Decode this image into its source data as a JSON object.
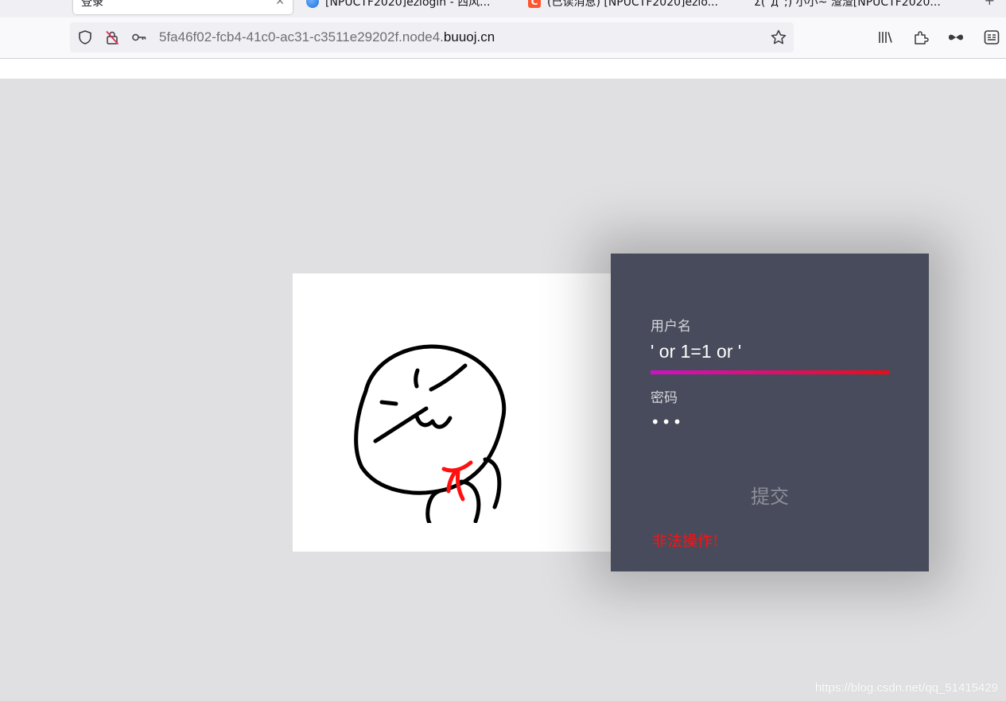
{
  "browser": {
    "tabs": [
      {
        "label": "登录",
        "active": true,
        "favicon": "none"
      },
      {
        "label": "[NPUCTF2020]ezlogin - 西风...",
        "active": false,
        "favicon": "globe-icon"
      },
      {
        "label": "(已读消息) [NPUCTF2020]ezlo...",
        "active": false,
        "favicon": "csdn-icon"
      },
      {
        "label": "Σ(ﾟдﾟ;) 小小~ 渣渣[NPUCTF2020...",
        "active": false,
        "favicon": "none"
      }
    ],
    "new_tab_label": "+",
    "url": {
      "prefix": "5fa46f02-fcb4-41c0-ac31-c3511e29202f.node4.",
      "host": "buuoj.cn"
    },
    "toolbar_icons": [
      "library-icon",
      "extensions-icon",
      "private-browsing-icon",
      "reader-view-icon"
    ]
  },
  "login": {
    "username_label": "用户名",
    "username_value": "' or 1=1 or '",
    "password_label": "密码",
    "password_value": "•••",
    "submit_label": "提交",
    "error_message": "非法操作!"
  },
  "colors": {
    "page_bg": "#e0e0e2",
    "panel_bg": "#484b5b",
    "underline_start": "#d010c8",
    "underline_end": "#f00a14",
    "error": "#ff1010"
  },
  "watermark": "https://blog.csdn.net/qq_51415429"
}
